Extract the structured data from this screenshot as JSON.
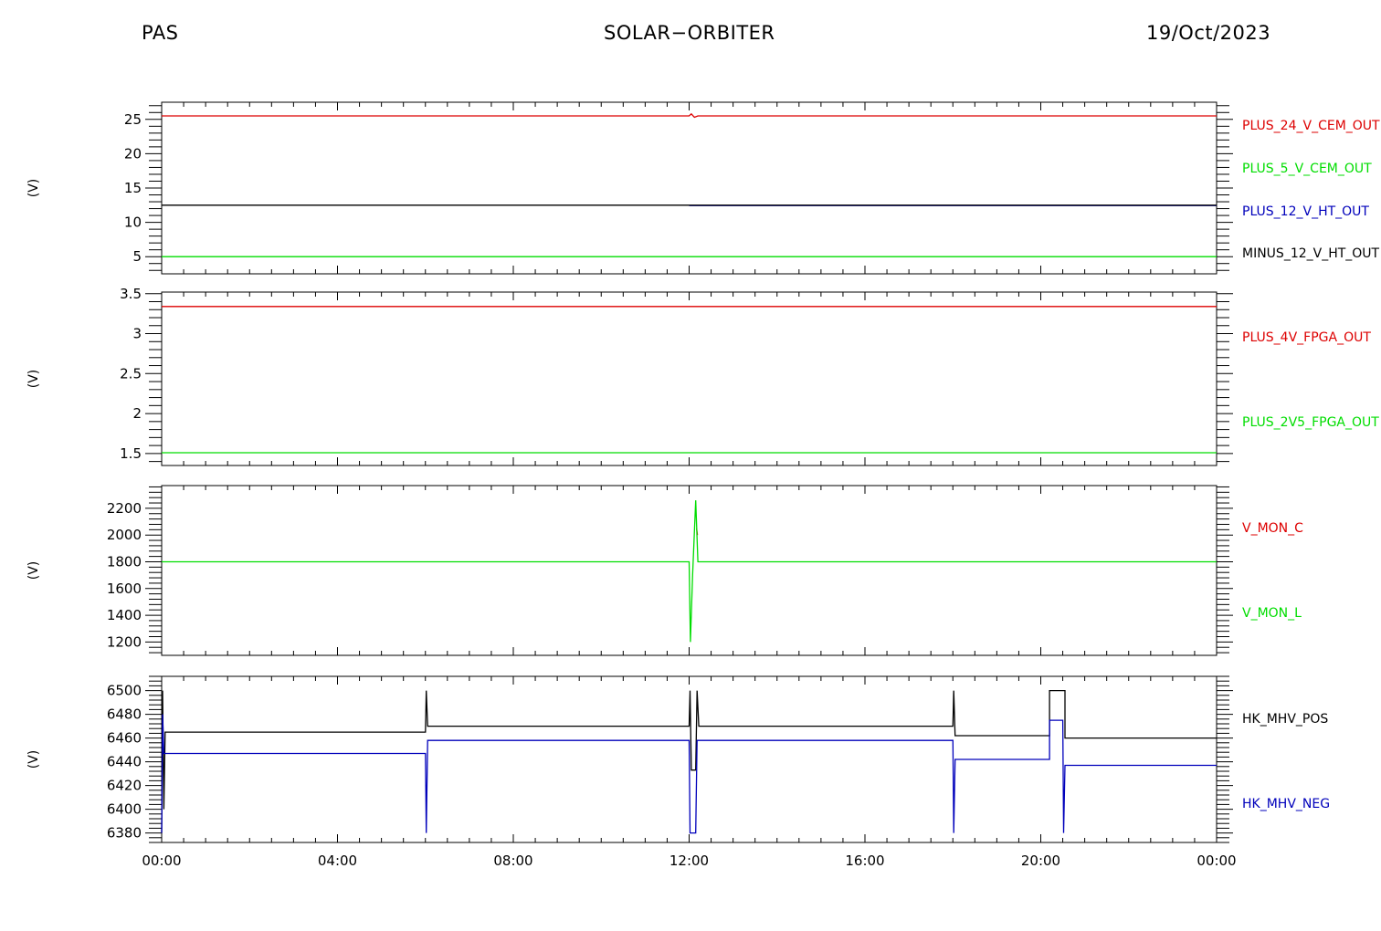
{
  "header": {
    "left": "PAS",
    "center": "SOLAR−ORBITER",
    "right": "19/Oct/2023"
  },
  "chart_data": [
    {
      "type": "line",
      "ylabel": "(V)",
      "ylim": [
        2.5,
        27.5
      ],
      "yticks": [
        5,
        10,
        15,
        20,
        25
      ],
      "xlim": [
        "00:00",
        "24:00"
      ],
      "series": [
        {
          "name": "PLUS_24_V_CEM_OUT",
          "color": "#dd0000",
          "points": [
            [
              0,
              25.5
            ],
            [
              12.0,
              25.5
            ],
            [
              12.05,
              25.8
            ],
            [
              12.12,
              25.3
            ],
            [
              12.2,
              25.5
            ],
            [
              24,
              25.5
            ]
          ]
        },
        {
          "name": "PLUS_5_V_CEM_OUT",
          "color": "#00dd00",
          "points": [
            [
              0,
              5.0
            ],
            [
              24,
              5.0
            ]
          ]
        },
        {
          "name": "PLUS_12_V_HT_OUT",
          "color": "#0000bb",
          "points": [
            [
              12.0,
              12.45
            ],
            [
              12.2,
              12.45
            ],
            [
              14.0,
              12.45
            ],
            [
              24,
              12.45
            ]
          ]
        },
        {
          "name": "MINUS_12_V_HT_OUT",
          "color": "#000000",
          "points": [
            [
              0,
              12.5
            ],
            [
              24,
              12.5
            ]
          ]
        }
      ]
    },
    {
      "type": "line",
      "ylabel": "(V)",
      "ylim": [
        1.35,
        3.52
      ],
      "yticks": [
        1.5,
        2.0,
        2.5,
        3.0,
        3.5
      ],
      "xlim": [
        "00:00",
        "24:00"
      ],
      "series": [
        {
          "name": "PLUS_4V_FPGA_OUT",
          "color": "#dd0000",
          "points": [
            [
              0,
              3.34
            ],
            [
              24,
              3.34
            ]
          ]
        },
        {
          "name": "PLUS_2V5_FPGA_OUT",
          "color": "#00dd00",
          "points": [
            [
              0,
              1.51
            ],
            [
              24,
              1.51
            ]
          ]
        }
      ]
    },
    {
      "type": "line",
      "ylabel": "(V)",
      "ylim": [
        1100,
        2370
      ],
      "yticks": [
        1200,
        1400,
        1600,
        1800,
        2000,
        2200
      ],
      "xlim": [
        "00:00",
        "24:00"
      ],
      "series": [
        {
          "name": "V_MON_C",
          "color": "#dd0000",
          "points": [
            [
              12.17,
              2050
            ],
            [
              12.19,
              2000
            ]
          ]
        },
        {
          "name": "V_MON_L",
          "color": "#00dd00",
          "points": [
            [
              0,
              1800
            ],
            [
              12.0,
              1800
            ],
            [
              12.03,
              1200
            ],
            [
              12.08,
              1700
            ],
            [
              12.15,
              2260
            ],
            [
              12.2,
              1800
            ],
            [
              24,
              1800
            ]
          ]
        }
      ]
    },
    {
      "type": "line",
      "ylabel": "(V)",
      "ylim": [
        6372,
        6512
      ],
      "yticks": [
        6380,
        6400,
        6420,
        6440,
        6460,
        6480,
        6500
      ],
      "xlim": [
        "00:00",
        "24:00"
      ],
      "xticks": [
        "00:00",
        "04:00",
        "08:00",
        "12:00",
        "16:00",
        "20:00",
        "00:00"
      ],
      "series": [
        {
          "name": "HK_MHV_POS",
          "color": "#000000",
          "points": [
            [
              0,
              6380
            ],
            [
              0.02,
              6500
            ],
            [
              0.05,
              6400
            ],
            [
              0.08,
              6465
            ],
            [
              6.0,
              6465
            ],
            [
              6.02,
              6500
            ],
            [
              6.05,
              6470
            ],
            [
              12.0,
              6470
            ],
            [
              12.02,
              6500
            ],
            [
              12.05,
              6433
            ],
            [
              12.15,
              6433
            ],
            [
              12.18,
              6500
            ],
            [
              12.22,
              6470
            ],
            [
              18.0,
              6470
            ],
            [
              18.02,
              6500
            ],
            [
              18.05,
              6462
            ],
            [
              20.2,
              6462
            ],
            [
              20.2,
              6500
            ],
            [
              20.55,
              6500
            ],
            [
              20.55,
              6460
            ],
            [
              24,
              6460
            ]
          ]
        },
        {
          "name": "HK_MHV_NEG",
          "color": "#0000bb",
          "points": [
            [
              0,
              6380
            ],
            [
              0.02,
              6480
            ],
            [
              0.05,
              6447
            ],
            [
              6.0,
              6447
            ],
            [
              6.02,
              6380
            ],
            [
              6.05,
              6458
            ],
            [
              12.0,
              6458
            ],
            [
              12.02,
              6380
            ],
            [
              12.15,
              6380
            ],
            [
              12.18,
              6458
            ],
            [
              18.0,
              6458
            ],
            [
              18.02,
              6380
            ],
            [
              18.05,
              6442
            ],
            [
              20.2,
              6442
            ],
            [
              20.2,
              6475
            ],
            [
              20.5,
              6475
            ],
            [
              20.52,
              6380
            ],
            [
              20.55,
              6437
            ],
            [
              24,
              6437
            ]
          ]
        }
      ]
    }
  ]
}
